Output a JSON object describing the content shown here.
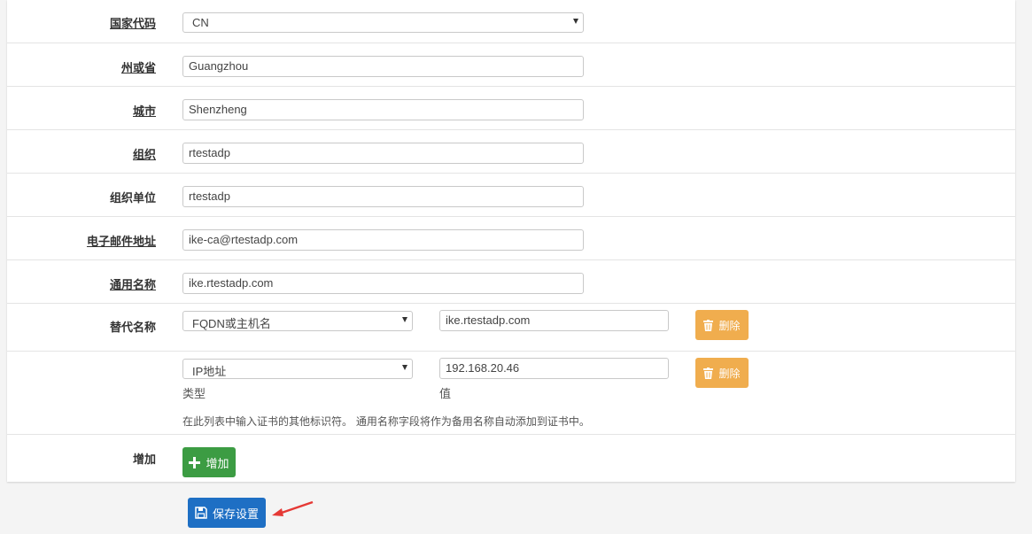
{
  "fields": {
    "country": {
      "label": "国家代码",
      "value": "CN"
    },
    "state": {
      "label": "州或省",
      "value": "Guangzhou"
    },
    "city": {
      "label": "城市",
      "value": "Shenzheng"
    },
    "org": {
      "label": "组织",
      "value": "rtestadp"
    },
    "org_unit": {
      "label": "组织单位",
      "value": "rtestadp"
    },
    "email": {
      "label": "电子邮件地址",
      "value": "ike-ca@rtestadp.com"
    },
    "common_name": {
      "label": "通用名称",
      "value": "ike.rtestadp.com"
    }
  },
  "alt_names": {
    "label": "替代名称",
    "rows": [
      {
        "type": "FQDN或主机名",
        "value": "ike.rtestadp.com",
        "delete_label": "删除"
      },
      {
        "type": "IP地址",
        "value": "192.168.20.46",
        "delete_label": "删除"
      }
    ],
    "type_caption": "类型",
    "value_caption": "值",
    "help": "在此列表中输入证书的其他标识符。 通用名称字段将作为备用名称自动添加到证书中。"
  },
  "add": {
    "label": "增加",
    "button_label": "增加"
  },
  "save_button_label": "保存设置",
  "colors": {
    "save": "#1e6fc4",
    "add": "#3c9c43",
    "delete": "#f0ad4e",
    "arrow": "#e53935"
  }
}
